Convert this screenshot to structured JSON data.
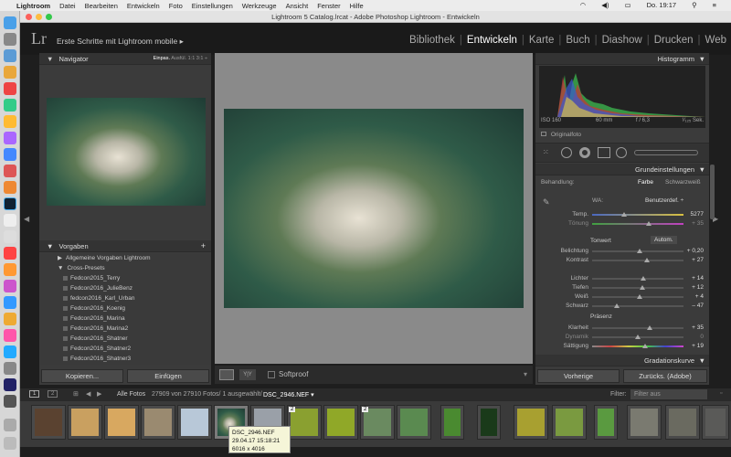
{
  "menubar": {
    "apple": "",
    "items": [
      "Lightroom",
      "Datei",
      "Bearbeiten",
      "Entwickeln",
      "Foto",
      "Einstellungen",
      "Werkzeuge",
      "Ansicht",
      "Fenster",
      "Hilfe"
    ],
    "day_time": "Do. 19:17"
  },
  "window": {
    "title": "Lightroom 5 Catalog.lrcat - Adobe Photoshop Lightroom - Entwickeln"
  },
  "header": {
    "logo": "Lr",
    "identity": "Erste Schritte mit Lightroom mobile ▸",
    "modules": [
      "Bibliothek",
      "Entwickeln",
      "Karte",
      "Buch",
      "Diashow",
      "Drucken",
      "Web"
    ],
    "active_module": "Entwickeln"
  },
  "navigator": {
    "title": "Navigator",
    "zoom_options": [
      "Einpas.",
      "Ausfül.",
      "1:1",
      "3:1 ÷"
    ]
  },
  "presets": {
    "title": "Vorgaben",
    "add": "+",
    "groups": [
      {
        "label": "Allgemeine Vorgaben Lightroom",
        "expanded": false
      },
      {
        "label": "Cross-Presets",
        "expanded": true
      }
    ],
    "items": [
      "Fedcon2015_Terry",
      "Fedcon2016_JulieBenz",
      "fedcon2016_Karl_Urban",
      "Fedcon2016_Koenig",
      "Fedcon2016_Marina",
      "Fedcon2016_Marina2",
      "Fedcon2016_Shatner",
      "Fedcon2016_Shatner2",
      "Fedcon2016_Shatner3"
    ],
    "copy_button": "Kopieren...",
    "paste_button": "Einfügen"
  },
  "histogram": {
    "title": "Histogramm",
    "iso": "ISO 160",
    "focal": "60 mm",
    "aperture": "f / 6,3",
    "shutter": "¹⁄₁₂₅ Sek.",
    "original_label": "Originalfoto"
  },
  "basic": {
    "title": "Grundeinstellungen",
    "treatment_label": "Behandlung:",
    "treatment_color": "Farbe",
    "treatment_bw": "Schwarzweiß",
    "wb_label": "WA:",
    "wb_value": "Benutzerdef. ÷",
    "tone_label": "Tonwert",
    "auto_label": "Autom.",
    "presence_label": "Präsenz",
    "sliders": [
      {
        "label": "Temp.",
        "value": "5277",
        "pos": 0.35,
        "dim": false
      },
      {
        "label": "Tönung",
        "value": "+ 35",
        "pos": 0.62,
        "dim": true
      },
      {
        "label": "Belichtung",
        "value": "+ 0,20",
        "pos": 0.52,
        "dim": false
      },
      {
        "label": "Kontrast",
        "value": "+ 27",
        "pos": 0.6,
        "dim": false
      },
      {
        "label": "Lichter",
        "value": "+ 14",
        "pos": 0.56,
        "dim": false
      },
      {
        "label": "Tiefen",
        "value": "+ 12",
        "pos": 0.55,
        "dim": false
      },
      {
        "label": "Weiß",
        "value": "+ 4",
        "pos": 0.52,
        "dim": false
      },
      {
        "label": "Schwarz",
        "value": "– 47",
        "pos": 0.27,
        "dim": false
      },
      {
        "label": "Klarheit",
        "value": "+ 35",
        "pos": 0.63,
        "dim": false
      },
      {
        "label": "Dynamik",
        "value": "0",
        "pos": 0.5,
        "dim": true
      },
      {
        "label": "Sättigung",
        "value": "+ 19",
        "pos": 0.58,
        "dim": false
      }
    ]
  },
  "tone_curve_title": "Gradationskurve",
  "right_buttons": {
    "previous": "Vorherige",
    "reset": "Zurücks. (Adobe)"
  },
  "toolbar": {
    "softproof": "Softproof"
  },
  "filmstrip": {
    "screen1": "1",
    "screen2": "2",
    "source": "Alle Fotos",
    "counts": "27909 von 27910 Fotos/ 1 ausgewählt/",
    "filename": "DSC_2946.NEF ▾",
    "filter_label": "Filter:",
    "filter_value": "Filter aus",
    "badges": [
      "2",
      "2"
    ]
  },
  "tooltip": {
    "name": "DSC_2946.NEF",
    "date": "29.04.17 15:18:21",
    "size": "6016 x 4016"
  },
  "colors": {
    "accent": "#ffffff",
    "panel": "#3b3b3b",
    "background": "#1e1e1e"
  }
}
